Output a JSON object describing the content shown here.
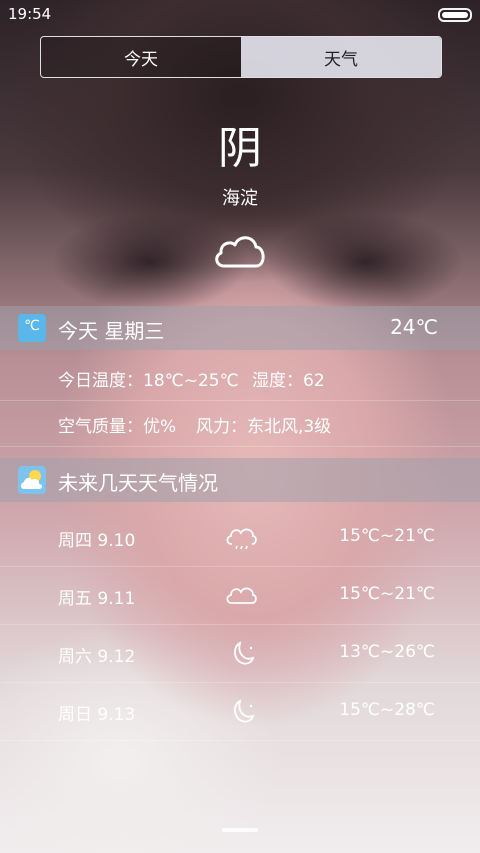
{
  "status": {
    "time": "19:54"
  },
  "tabs": [
    {
      "label": "今天"
    },
    {
      "label": "天气"
    }
  ],
  "current": {
    "condition": "阴",
    "district": "海淀",
    "icon": "cloud-icon"
  },
  "today": {
    "title": "今天 星期三",
    "temp": "24℃",
    "icon_text": "℃",
    "temp_range": "今日温度：18℃~25℃",
    "humidity": "湿度：62",
    "air_quality": "空气质量：优%",
    "wind": "风力：东北风,3级"
  },
  "forecast": {
    "title": "未来几天天气情况",
    "icon": "cloud-sun-icon",
    "days": [
      {
        "day": "周四 9.10",
        "temp": "15℃~21℃",
        "icon": "cloud-rain-icon"
      },
      {
        "day": "周五 9.11",
        "temp": "15℃~21℃",
        "icon": "cloud-icon"
      },
      {
        "day": "周六 9.12",
        "temp": "13℃~26℃",
        "icon": "moon-icon"
      },
      {
        "day": "周日 9.13",
        "temp": "15℃~28℃",
        "icon": "moon-icon"
      }
    ]
  },
  "colors": {
    "accent": "#5bb7ea",
    "tab_selected": "#e6e6f0"
  }
}
